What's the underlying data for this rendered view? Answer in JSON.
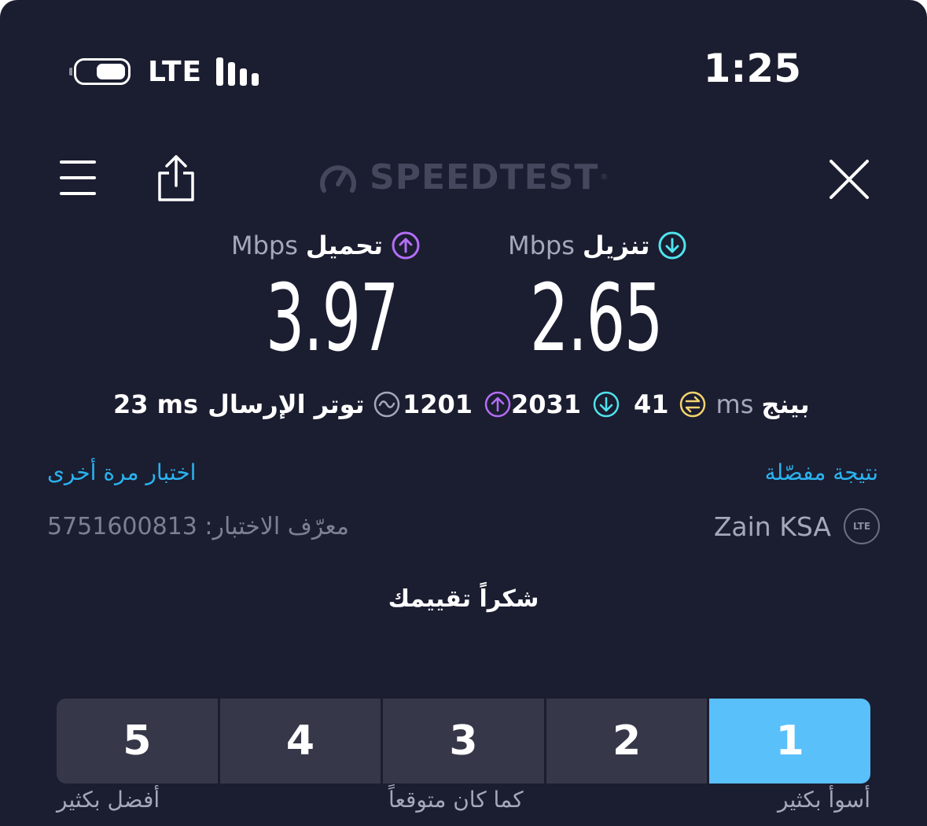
{
  "status_bar": {
    "network": "LTE",
    "time": "1:25",
    "signal_level": 0.5
  },
  "header": {
    "logo": "SPEEDTEST",
    "logo_mark": "®",
    "menu_icon": "hamburger-icon",
    "share_icon": "share-icon",
    "close_icon": "close-icon"
  },
  "results": {
    "upload": {
      "label": "تحميل",
      "unit": "Mbps",
      "value": "3.97",
      "icon": "arrow-up-circle-icon",
      "color": "#b36ef6"
    },
    "download": {
      "label": "تنزيل",
      "unit": "Mbps",
      "value": "2.65",
      "icon": "arrow-down-circle-icon",
      "color": "#4fe3ee"
    }
  },
  "stats": {
    "ping_label": "بينج",
    "ping_unit": "ms",
    "ping_value": "41",
    "ping_color": "#f3d46e",
    "download_latency": "2031",
    "upload_latency": "1201",
    "jitter_label": "توتر الإرسال",
    "jitter_value": "23 ms"
  },
  "links": {
    "detailed_result": "نتيجة مفصّلة",
    "test_again": "اختبار مرة أخرى"
  },
  "test_info": {
    "test_id": "معرّف الاختبار: 5751600813",
    "provider": "Zain KSA",
    "badge": "LTE"
  },
  "rating": {
    "prompt": "شكراً تقييمك",
    "options": [
      "1",
      "2",
      "3",
      "4",
      "5"
    ],
    "selected": "1",
    "captions": {
      "worst": "أسوأ بكثير",
      "expected": "كما كان متوقعاً",
      "best": "أفضل بكثير"
    },
    "selected_color": "#5ac0fa"
  }
}
